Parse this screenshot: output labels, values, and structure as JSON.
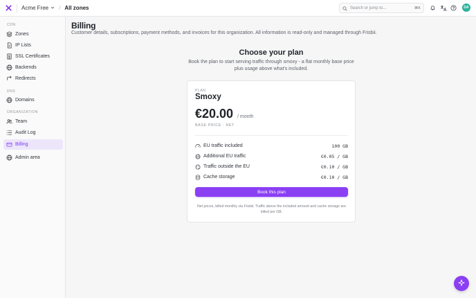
{
  "topbar": {
    "org_name": "Acme Free",
    "separator": "/",
    "zone_scope": "All zones",
    "search_placeholder": "Search or jump to...",
    "search_shortcut": "⌘K",
    "avatar_initials": "DA"
  },
  "sidebar": {
    "sections": [
      {
        "title": "CDN",
        "items": [
          {
            "label": "Zones",
            "icon": "zones-icon"
          },
          {
            "label": "IP Lists",
            "icon": "document-icon"
          },
          {
            "label": "SSL Certificates",
            "icon": "certificate-icon"
          },
          {
            "label": "Backends",
            "icon": "globe-icon"
          },
          {
            "label": "Redirects",
            "icon": "redirect-icon"
          }
        ]
      },
      {
        "title": "DNS",
        "items": [
          {
            "label": "Domains",
            "icon": "globe-icon"
          }
        ]
      },
      {
        "title": "ORGANIZATION",
        "items": [
          {
            "label": "Team",
            "icon": "team-icon"
          },
          {
            "label": "Audit Log",
            "icon": "list-icon"
          },
          {
            "label": "Billing",
            "icon": "credit-card-icon",
            "active": true
          }
        ]
      }
    ],
    "admin_label": "Admin area"
  },
  "page": {
    "title": "Billing",
    "subtitle": "Customer details, subscriptions, payment methods, and invoices for this organization. All information is read-only and managed through Frisbii."
  },
  "plan_section": {
    "title": "Choose your plan",
    "subtitle": "Book the plan to start serving traffic through smoxy - a flat monthly base price plus usage above what's included."
  },
  "plan": {
    "label": "PLAN",
    "name": "Smoxy",
    "price": "€20.00",
    "period": "/ month",
    "base_note": "BASE PRICE · NET",
    "features": [
      {
        "label": "EU traffic included",
        "value": "100 GB",
        "icon": "gauge-icon"
      },
      {
        "label": "Additional EU traffic",
        "value": "€0.05 / GB",
        "icon": "globe-icon"
      },
      {
        "label": "Traffic outside the EU",
        "value": "€0.10 / GB",
        "icon": "globe-alt-icon"
      },
      {
        "label": "Cache storage",
        "value": "€0.10 / GB",
        "icon": "database-icon"
      }
    ],
    "button_label": "Book this plan",
    "footnote": "Net prices, billed monthly via Frisbii. Traffic above the included amount and cache storage are billed per GB."
  },
  "colors": {
    "accent": "#8a3ff3",
    "active_bg": "#ede6fb",
    "avatar": "#2fb29c"
  }
}
